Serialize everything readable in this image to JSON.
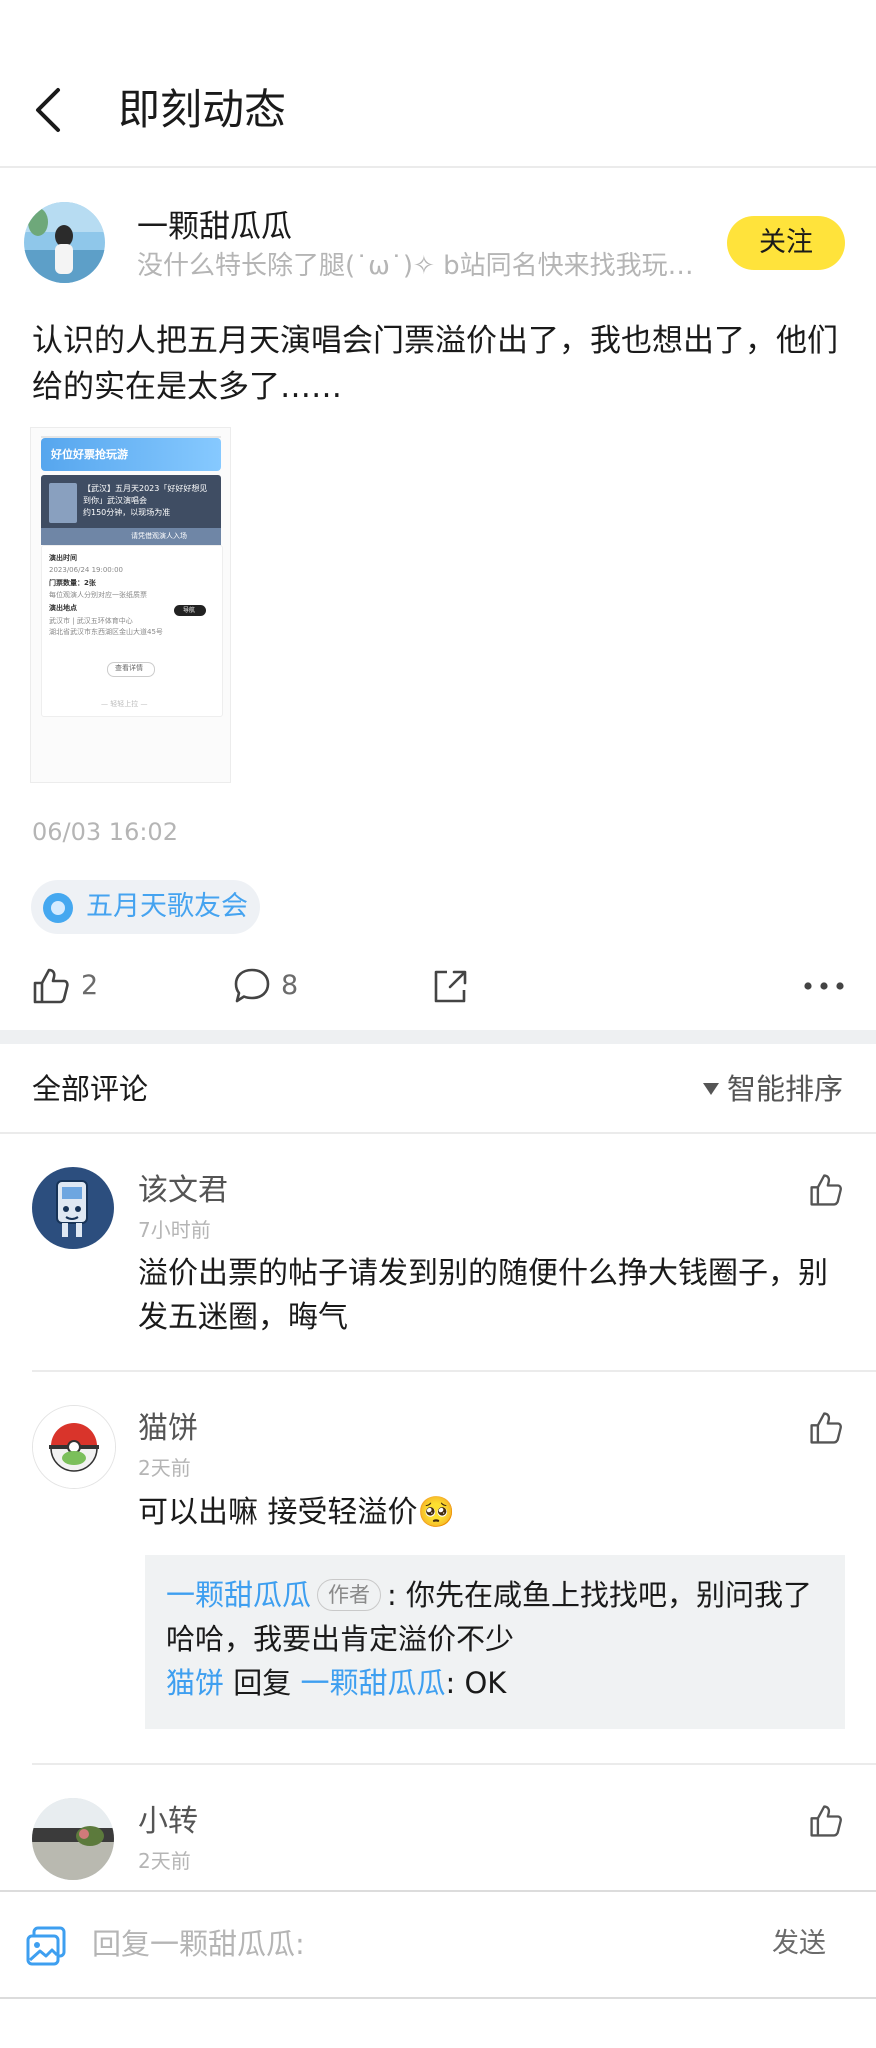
{
  "header": {
    "title": "即刻动态"
  },
  "post": {
    "author": {
      "name": "一颗甜瓜瓜",
      "bio": "没什么特长除了腿(˙ω˙)✧ b站同名快来找我玩！ 欢迎来玩"
    },
    "follow_label": "关注",
    "text": "认识的人把五月天演唱会门票溢价出了，我也想出了，他们给的实在是太多了……",
    "image": {
      "banner_text": "好位好票抢玩游",
      "card_title": "【武汉】五月天2023「好好好想见到你」武汉演唱会",
      "card_sub": "约150分钟，以现场为准",
      "card_bar": "请凭借观演人入场",
      "show_time_label": "演出时间",
      "show_time": "2023/06/24 19:00:00",
      "ticket_count": "门票数量：2张",
      "ticket_note": "每位观演人分别对应一张纸质票",
      "venue_label": "演出地点",
      "venue_city": "武汉市 | 武汉五环体育中心",
      "venue_address": "湖北省武汉市东西湖区金山大道45号",
      "nav_label": "导航",
      "details_label": "查看详情",
      "footer_text": "— 轻轻上拉 —"
    },
    "time": "06/03 16:02",
    "topic": "五月天歌友会",
    "likes": "2",
    "comments": "8"
  },
  "comments_section": {
    "title": "全部评论",
    "sort_label": "智能排序"
  },
  "comments": [
    {
      "name": "该文君",
      "time": "7小时前",
      "text": "溢价出票的帖子请发到别的随便什么挣大钱圈子，别发五迷圈，晦气"
    },
    {
      "name": "猫饼",
      "time": "2天前",
      "text": "可以出嘛  接受轻溢价🥺",
      "replies": [
        {
          "author": "一颗甜瓜瓜",
          "author_tag": "作者",
          "text": ": 你先在咸鱼上找找吧，别问我了哈哈，我要出肯定溢价不少"
        },
        {
          "author": "猫饼",
          "reply_word": "回复",
          "target": "一颗甜瓜瓜",
          "text": ": OK"
        }
      ]
    },
    {
      "name": "小转",
      "time": "2天前"
    }
  ],
  "bottom_bar": {
    "placeholder": "回复一颗甜瓜瓜:",
    "send_label": "发送"
  },
  "colors": {
    "accent_yellow": "#ffe33b",
    "link_blue": "#3e9ff0",
    "muted_gray": "#b5b5b5"
  }
}
